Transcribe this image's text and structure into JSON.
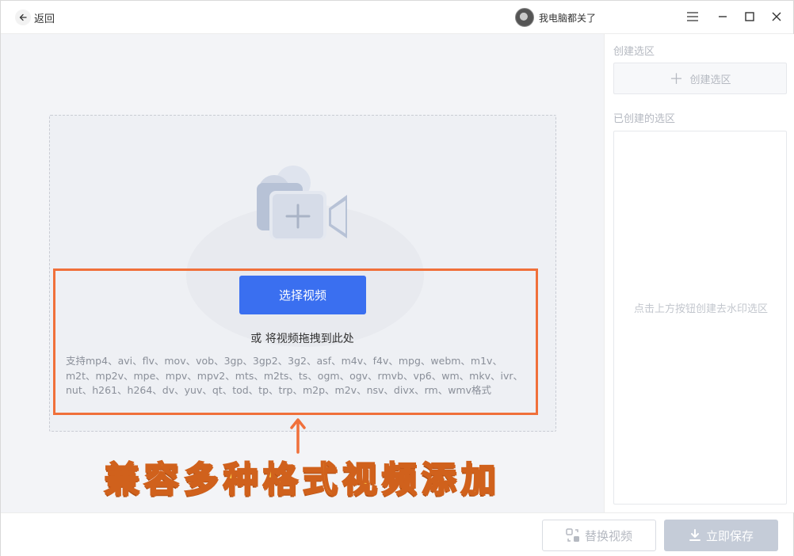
{
  "titlebar": {
    "back_label": "返回",
    "username": "我电脑都关了"
  },
  "main": {
    "select_button": "选择视频",
    "drag_hint": "或 将视频拖拽到此处",
    "formats_line1": "支持mp4、avi、flv、mov、vob、3gp、3gp2、3g2、asf、m4v、f4v、mpg、webm、m1v、",
    "formats_line2": "m2t、mp2v、mpe、mpv、mpv2、mts、m2ts、ts、ogm、ogv、rmvb、vp6、wm、mkv、ivr、",
    "formats_line3": "nut、h261、h264、dv、yuv、qt、tod、tp、trp、m2p、m2v、nsv、divx、rm、wmv格式",
    "banner": "兼容多种格式视频添加"
  },
  "panel": {
    "create_title": "创建选区",
    "create_button": "创建选区",
    "created_title": "已创建的选区",
    "empty_hint": "点击上方按钮创建去水印选区"
  },
  "bottombar": {
    "replace_button": "替换视频",
    "save_button": "立即保存"
  },
  "colors": {
    "primary": "#3a6ff0",
    "highlight": "#f0703a",
    "banner_fill": "#ffd24a",
    "disabled": "#c5ccd8"
  },
  "icons": [
    "back-arrow-icon",
    "avatar",
    "menu-icon",
    "minimize-icon",
    "maximize-icon",
    "close-icon",
    "camera-add-icon",
    "plus-icon",
    "replace-icon",
    "download-icon"
  ]
}
